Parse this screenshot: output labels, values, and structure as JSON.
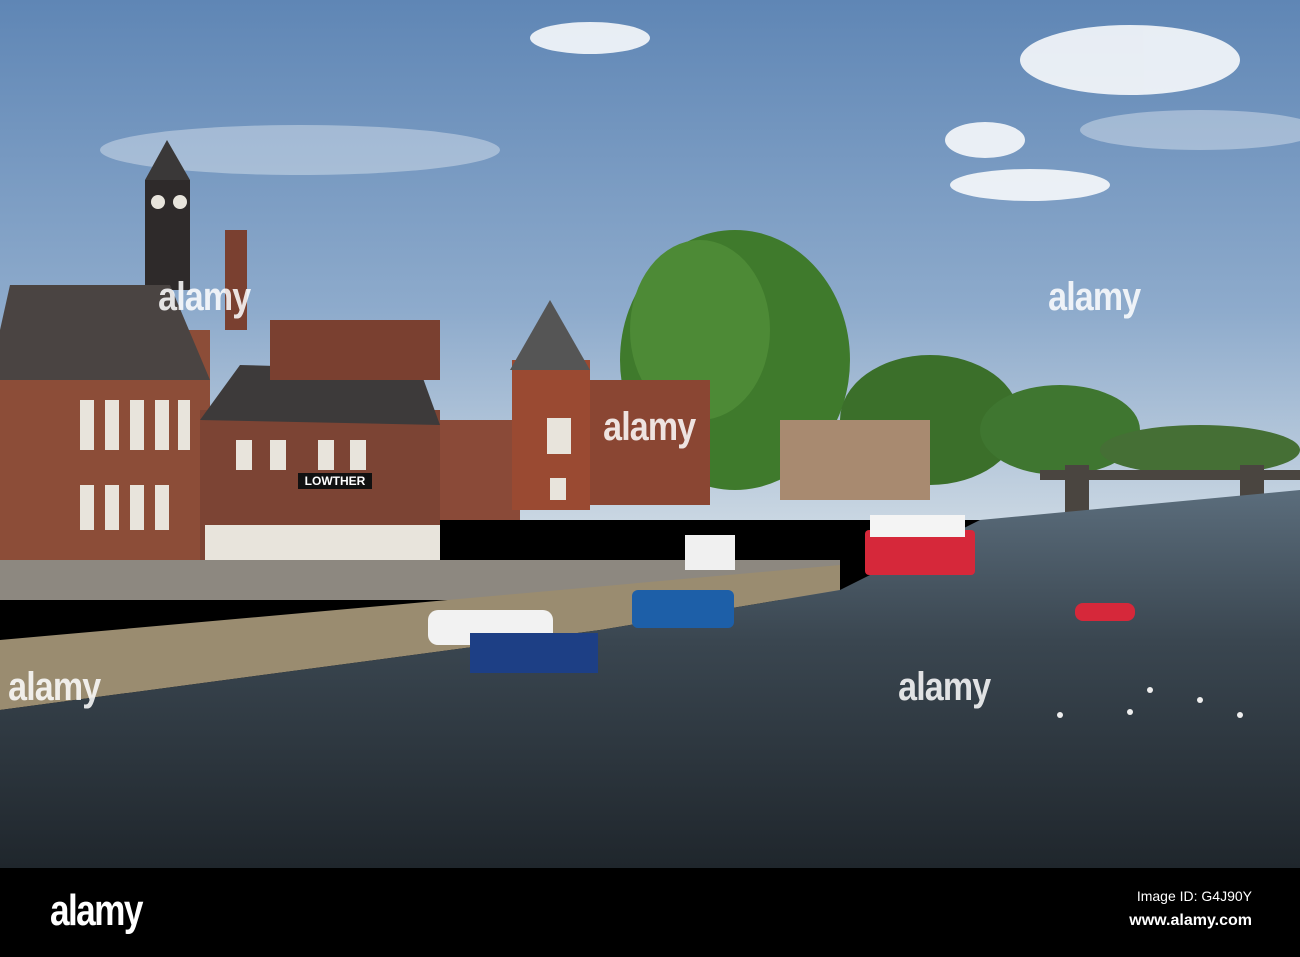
{
  "photo": {
    "subject": "riverside",
    "pub_sign": "LOWTHER",
    "colors": {
      "sky": "#6f93bd",
      "water": "#2a3540",
      "brick": "#8a4a35",
      "tree": "#3f7a2c",
      "boat_red": "#d6283a",
      "boat_blue": "#1d4f95"
    }
  },
  "watermark": {
    "text": "alamy"
  },
  "footer": {
    "logo": "alamy",
    "image_id": "Image ID: G4J90Y",
    "site": "www.alamy.com"
  }
}
